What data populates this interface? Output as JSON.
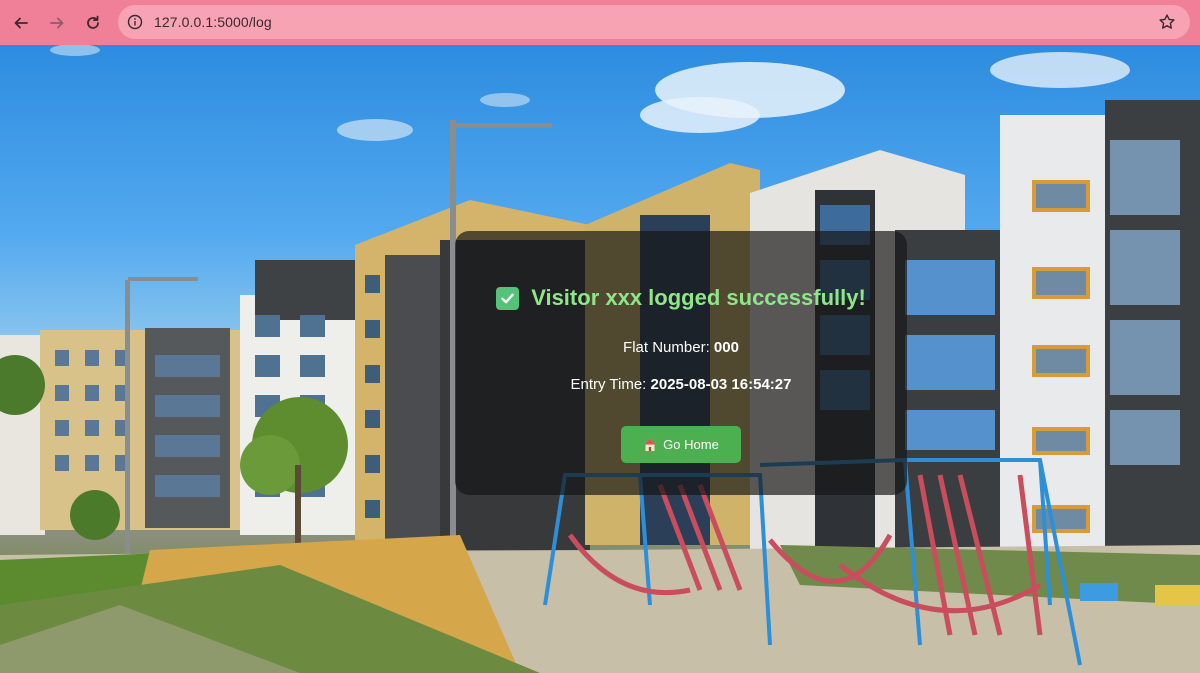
{
  "browser": {
    "url": "127.0.0.1:5000/log",
    "back_icon": "arrow-left-icon",
    "forward_icon": "arrow-right-icon",
    "reload_icon": "reload-icon",
    "site_info_icon": "info-icon",
    "bookmark_icon": "star-icon"
  },
  "result": {
    "status_icon": "check-box-icon",
    "title": "Visitor xxx logged successfully!",
    "flat_label": "Flat Number:",
    "flat_value": "000",
    "time_label": "Entry Time:",
    "time_value": "2025-08-03 16:54:27",
    "home_icon": "house-icon",
    "home_button_label": "Go Home"
  },
  "colors": {
    "chrome": "#f07f98",
    "title_text": "#8ee689",
    "button": "#4caf50"
  }
}
